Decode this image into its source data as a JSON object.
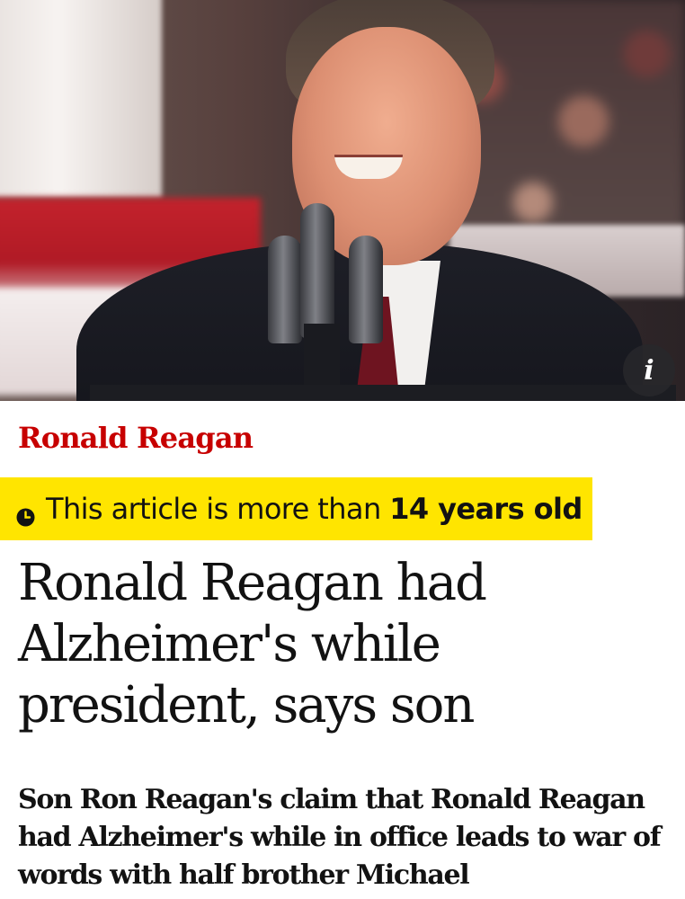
{
  "hero": {
    "image_label": "Ronald Reagan speaking at microphones",
    "info_icon": "info-icon",
    "info_glyph": "i"
  },
  "article": {
    "kicker": "Ronald Reagan",
    "age_warning": {
      "icon": "clock-icon",
      "prefix": "This article is more than ",
      "highlight": "14 years old"
    },
    "headline": "Ronald Reagan had Alzheimer's while president, says son",
    "standfirst": "Son Ron Reagan's claim that Ronald Reagan had Alzheimer's while in office leads to war of words with half brother Michael"
  },
  "colors": {
    "kicker": "#c70000",
    "warning_bg": "#ffe500",
    "text": "#121212"
  }
}
